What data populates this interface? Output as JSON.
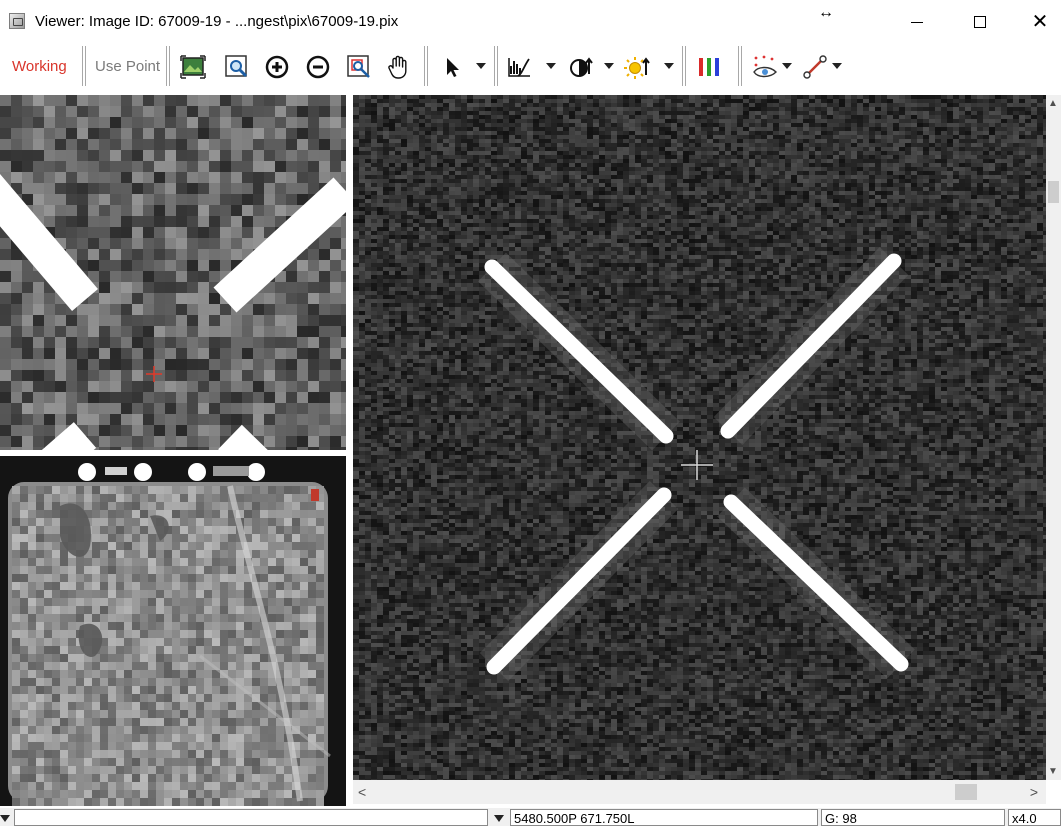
{
  "window": {
    "title": "Viewer: Image ID: 67009-19 - ...ngest\\pix\\67009-19.pix",
    "resize_glyph": "↔",
    "close_glyph": "✕"
  },
  "toolbar": {
    "mode_label": "Working",
    "use_point_label": "Use Point",
    "icons": [
      "fit-image-icon",
      "zoom-window-icon",
      "zoom-in-icon",
      "zoom-out-icon",
      "zoom-box-icon",
      "pan-hand-icon",
      "pointer-icon",
      "histogram-icon",
      "contrast-icon",
      "brightness-icon",
      "rgb-channels-icon",
      "overlay-eye-icon",
      "measure-line-icon"
    ]
  },
  "colors": {
    "accent_working": "#d9352b",
    "crosshair_zoom": "#e03a2a",
    "crosshair_main": "#d8d8d8"
  },
  "status": {
    "coordinates": "5480.500P 671.750L",
    "gray_value": "G: 98",
    "zoom": "x4.0"
  },
  "scroll": {
    "up": "▲",
    "down": "▼",
    "left": "<",
    "right": ">"
  }
}
